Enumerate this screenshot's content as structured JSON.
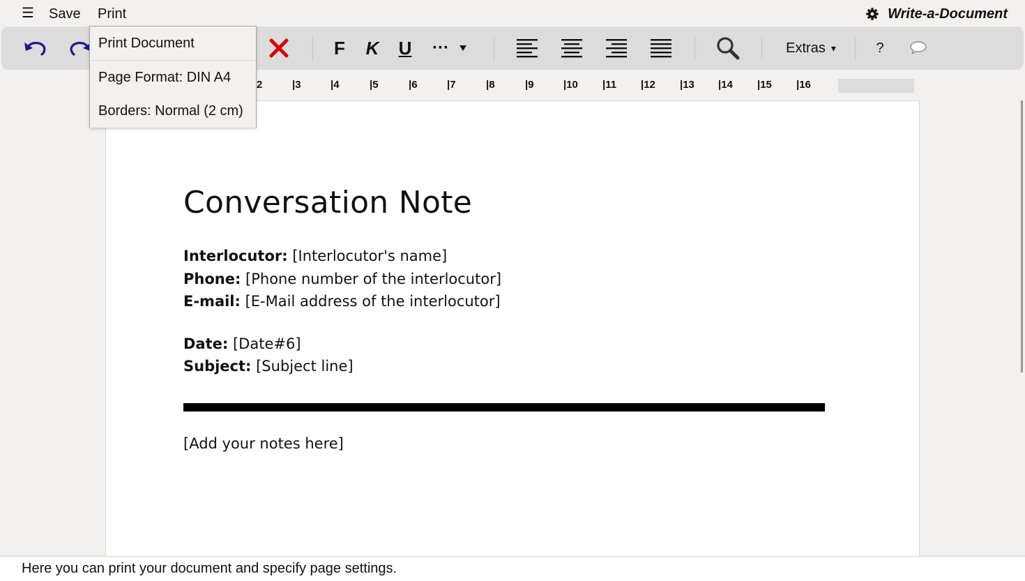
{
  "menubar": {
    "menu_icon": "hamburger-menu-icon",
    "menu_glyph": "☰",
    "save_label": "Save",
    "print_label": "Print",
    "app_title": "Write-a-Document",
    "settings_icon": "gear-icon"
  },
  "print_menu": {
    "items": [
      {
        "label": "Print Document"
      },
      {
        "label": "Page Format: DIN A4"
      },
      {
        "label": "Borders: Normal (2 cm)"
      }
    ]
  },
  "toolbar": {
    "undo_icon": "undo-icon",
    "redo_icon": "redo-icon",
    "delete_icon": "delete-x-icon",
    "bold_label": "F",
    "italic_label": "K",
    "underline_label": "U",
    "more_label": "···",
    "more_dropdown_icon": "triangle-down-icon",
    "align_left_icon": "align-left-icon",
    "align_center_icon": "align-center-icon",
    "align_right_icon": "align-right-icon",
    "justify_icon": "align-justify-icon",
    "search_icon": "magnifier-icon",
    "extras_label": "Extras",
    "extras_arrow": "▾",
    "help_label": "?",
    "comment_icon": "speech-bubble-icon",
    "accent_color": "#1a1a8c",
    "delete_color": "#dd0000"
  },
  "ruler": {
    "marks": [
      "2",
      "|3",
      "|4",
      "|5",
      "|6",
      "|7",
      "|8",
      "|9",
      "|10",
      "|11",
      "|12",
      "|13",
      "|14",
      "|15",
      "|16"
    ]
  },
  "document": {
    "title": "Conversation Note",
    "interlocutor_label": "Interlocutor:",
    "interlocutor_value": " [Interlocutor's name]",
    "phone_label": "Phone:",
    "phone_value": " [Phone number of the interlocutor]",
    "email_label": "E-mail:",
    "email_value": " [E-Mail address of the interlocutor]",
    "date_label": "Date:",
    "date_value": " [Date#6]",
    "subject_label": "Subject:",
    "subject_value": " [Subject line]",
    "notes_placeholder": "[Add your notes here]"
  },
  "statusbar": {
    "message": "Here you can print your document and specify page settings."
  }
}
